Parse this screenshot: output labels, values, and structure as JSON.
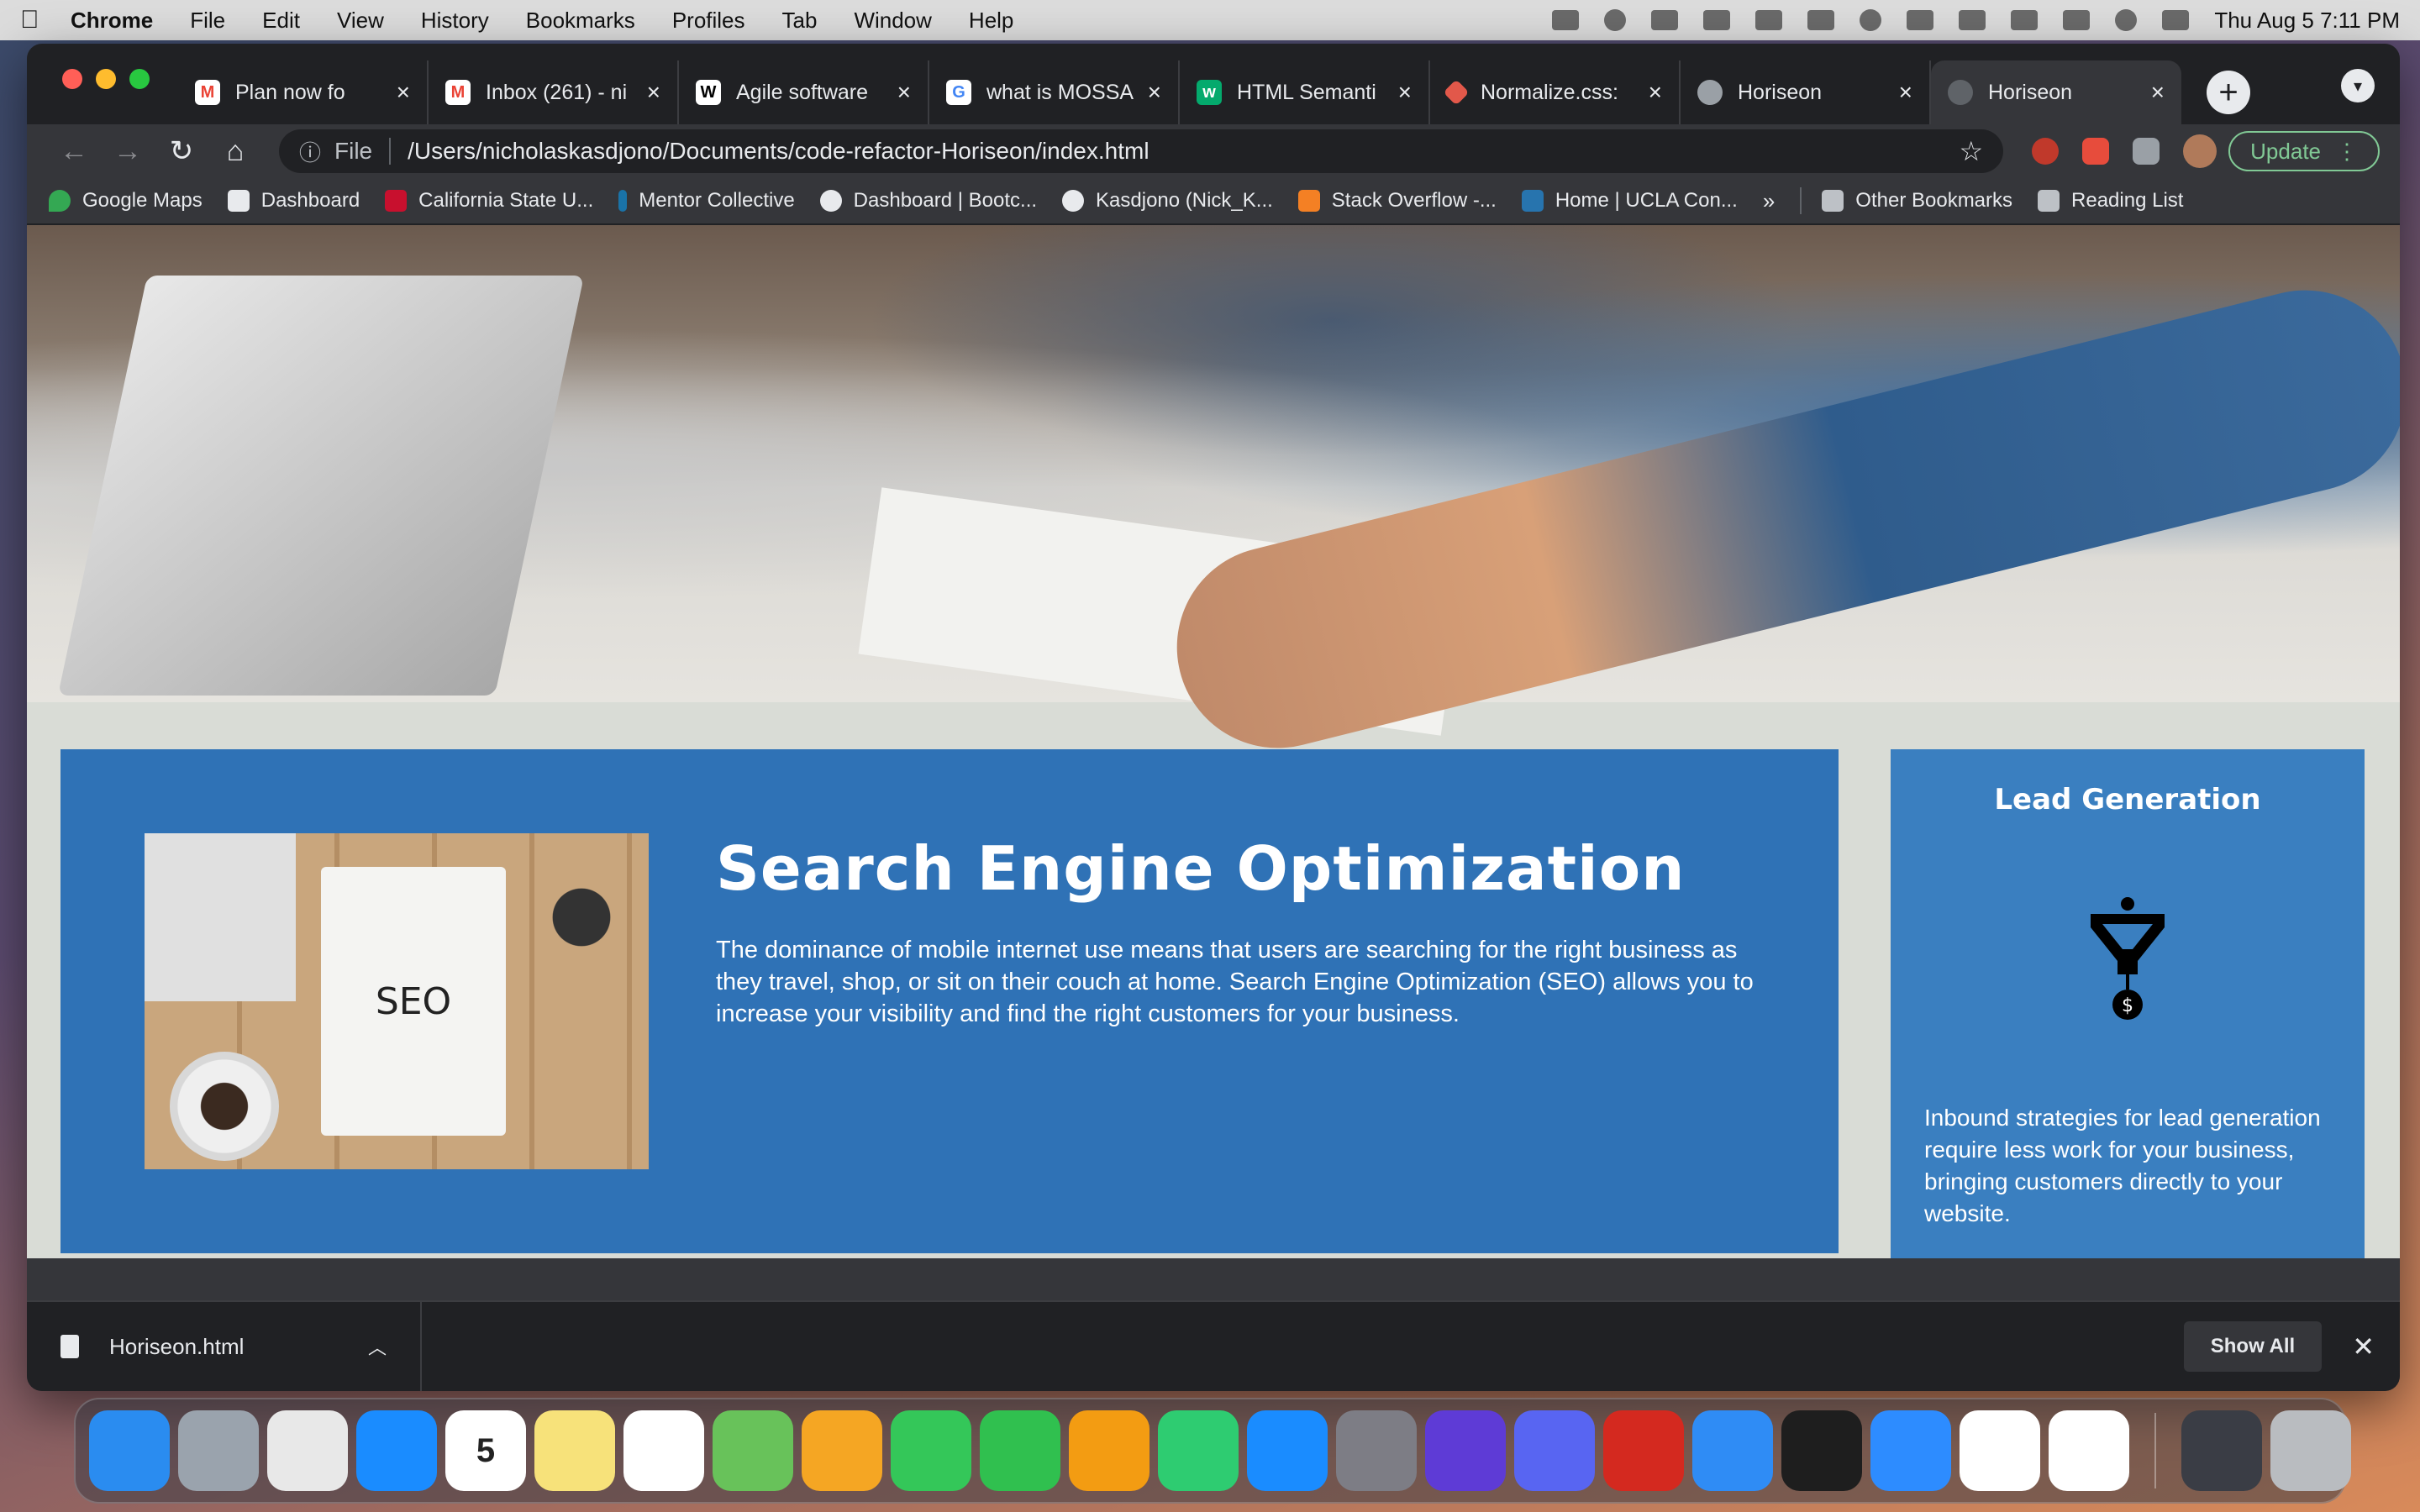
{
  "menubar": {
    "apple": "",
    "app_name": "Chrome",
    "items": [
      "File",
      "Edit",
      "View",
      "History",
      "Bookmarks",
      "Profiles",
      "Tab",
      "Window",
      "Help"
    ],
    "clock": "Thu Aug 5  7:11 PM"
  },
  "browser": {
    "tabs": [
      {
        "title": "Plan now fo",
        "favicon": "gmail-icon",
        "color": "#ea4335"
      },
      {
        "title": "Inbox (261) - ni",
        "favicon": "gmail-icon",
        "color": "#ea4335"
      },
      {
        "title": "Agile software",
        "favicon": "wikipedia-icon",
        "color": "#ffffff"
      },
      {
        "title": "what is MOSSA",
        "favicon": "google-icon",
        "color": "#4285f4"
      },
      {
        "title": "HTML Semanti",
        "favicon": "w3schools-icon",
        "color": "#04aa6d"
      },
      {
        "title": "Normalize.css:",
        "favicon": "normalize-icon",
        "color": "#e2584a"
      },
      {
        "title": "Horiseon",
        "favicon": "globe-icon",
        "color": "#9aa0a6"
      },
      {
        "title": "Horiseon",
        "favicon": "page-icon",
        "color": "#5f6368"
      }
    ],
    "address": {
      "scheme": "File",
      "url": "/Users/nicholaskasdjono/Documents/code-refactor-Horiseon/index.html"
    },
    "update_label": "Update",
    "bookmarks": [
      {
        "label": "Google Maps",
        "color": "#34a853"
      },
      {
        "label": "Dashboard",
        "color": "#ffffff"
      },
      {
        "label": "California State U...",
        "color": "#c8102e"
      },
      {
        "label": "Mentor Collective",
        "color": "#1a73a8"
      },
      {
        "label": "Dashboard | Bootc...",
        "color": "#e8eaed"
      },
      {
        "label": "Kasdjono (Nick_K...",
        "color": "#e8eaed"
      },
      {
        "label": "Stack Overflow -...",
        "color": "#f48024"
      },
      {
        "label": "Home | UCLA Con...",
        "color": "#2774ae"
      }
    ],
    "bookmarks_more": "»",
    "other_bookmarks": "Other Bookmarks",
    "reading_list": "Reading List"
  },
  "page": {
    "seo": {
      "title": "Search Engine Optimization",
      "text": "The dominance of mobile internet use means that users are searching for the right business as they travel, shop, or sit on their couch at home. Search Engine Optimization (SEO) allows you to increase your visibility and find the right customers for your business.",
      "image_label": "SEO"
    },
    "lead": {
      "title": "Lead Generation",
      "text": "Inbound strategies for lead generation require less work for your business, bringing customers directly to your website."
    }
  },
  "downloads": {
    "file": "Horiseon.html",
    "show_all": "Show All"
  },
  "dock": {
    "apps": [
      {
        "name": "finder",
        "color": "#2a8cf0"
      },
      {
        "name": "launchpad",
        "color": "#9aa3ad"
      },
      {
        "name": "chrome",
        "color": "#e8e8e8"
      },
      {
        "name": "safari",
        "color": "#1a8cff"
      },
      {
        "name": "calendar",
        "color": "#ffffff",
        "label": "5"
      },
      {
        "name": "notes",
        "color": "#f7e27a"
      },
      {
        "name": "reminders",
        "color": "#ffffff"
      },
      {
        "name": "maps",
        "color": "#68c25a"
      },
      {
        "name": "photos",
        "color": "#f5a623"
      },
      {
        "name": "messages",
        "color": "#34c759"
      },
      {
        "name": "facetime",
        "color": "#30c04f"
      },
      {
        "name": "pages",
        "color": "#f39c12"
      },
      {
        "name": "numbers",
        "color": "#2ecc71"
      },
      {
        "name": "app-store",
        "color": "#1a8cff"
      },
      {
        "name": "system-preferences",
        "color": "#7d7d85"
      },
      {
        "name": "siri",
        "color": "#5e3bd6"
      },
      {
        "name": "discord",
        "color": "#5865f2"
      },
      {
        "name": "acrobat",
        "color": "#d4291f"
      },
      {
        "name": "mail",
        "color": "#2f8cf5"
      },
      {
        "name": "terminal",
        "color": "#1e1e1e"
      },
      {
        "name": "zoom",
        "color": "#2d8cff"
      },
      {
        "name": "slack",
        "color": "#ffffff"
      },
      {
        "name": "vscode",
        "color": "#ffffff"
      }
    ],
    "accent": "#2f72b6"
  },
  "colors": {
    "seo_bg": "#2f72b6",
    "lead_bg": "#3a7fc0",
    "page_bg": "#d9dcd6"
  }
}
